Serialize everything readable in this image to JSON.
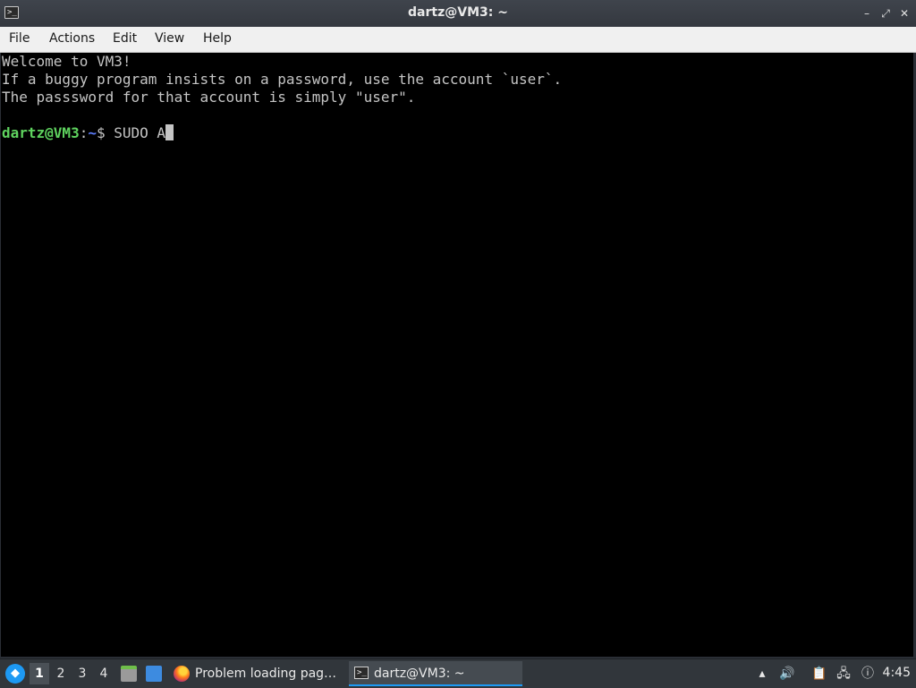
{
  "window": {
    "title": "dartz@VM3: ~",
    "app_icon": "terminal-icon",
    "controls": {
      "minimize": "–",
      "restore": "⤢",
      "close": "✕"
    }
  },
  "menu": {
    "items": [
      "File",
      "Actions",
      "Edit",
      "View",
      "Help"
    ]
  },
  "terminal": {
    "lines": [
      "Welcome to VM3!",
      "If a buggy program insists on a password, use the account `user`.",
      "The passsword for that account is simply \"user\"."
    ],
    "prompt_user_host": "dartz@VM3",
    "prompt_sep": ":",
    "prompt_path": "~",
    "prompt_symbol": "$ ",
    "current_input": "SUDO A"
  },
  "taskbar": {
    "start_icon": "app-launcher-icon",
    "desktops": [
      "1",
      "2",
      "3",
      "4"
    ],
    "active_desktop": "1",
    "tasks": [
      {
        "label": "Problem loading pag…",
        "icon": "firefox-icon"
      },
      {
        "label": "dartz@VM3: ~",
        "icon": "terminal-icon"
      }
    ],
    "clock": "4:45"
  },
  "colors": {
    "terminal_bg": "#000000",
    "terminal_fg": "#c5c5c5",
    "prompt_user": "#5fd35f",
    "prompt_path": "#5c7cfa",
    "taskbar_bg": "#31363b",
    "accent": "#1d99f3"
  }
}
